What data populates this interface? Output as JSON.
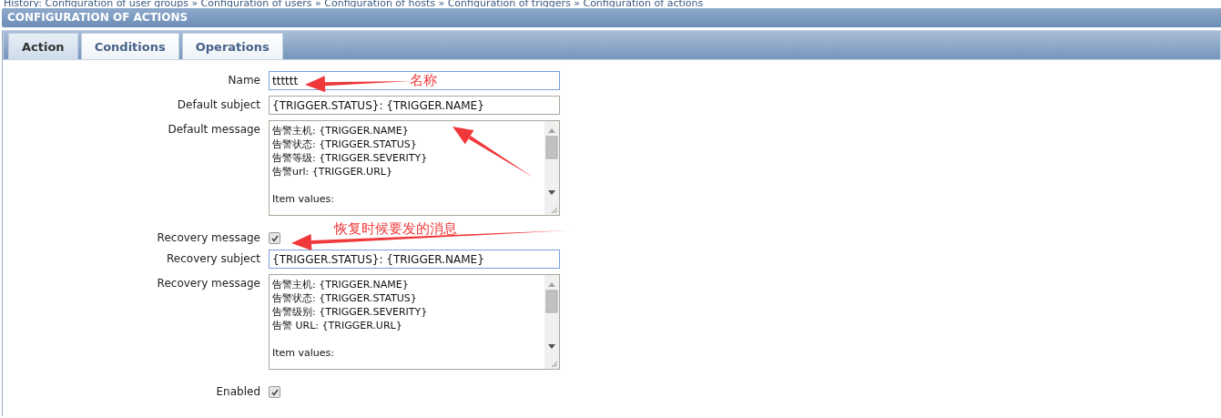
{
  "breadcrumb": "History: Configuration of user groups » Configuration of users » Configuration of hosts » Configuration of triggers » Configuration of actions",
  "header": {
    "title": "CONFIGURATION OF ACTIONS"
  },
  "tabs": [
    {
      "label": "Action",
      "selected": true
    },
    {
      "label": "Conditions",
      "selected": false
    },
    {
      "label": "Operations",
      "selected": false
    }
  ],
  "form": [
    {
      "kind": "input",
      "label": "Name",
      "value": "tttttt",
      "focused": true
    },
    {
      "kind": "input",
      "label": "Default subject",
      "value": "{TRIGGER.STATUS}: {TRIGGER.NAME}",
      "focused": false
    },
    {
      "kind": "textarea",
      "label": "Default message",
      "value": "告警主机: {TRIGGER.NAME}\n告警状态: {TRIGGER.STATUS}\n告警等级: {TRIGGER.SEVERITY}\n告警url: {TRIGGER.URL}\n\nItem values:"
    },
    {
      "kind": "checkbox",
      "label": "Recovery message",
      "checked": true
    },
    {
      "kind": "input",
      "label": "Recovery subject",
      "value": "{TRIGGER.STATUS}: {TRIGGER.NAME}",
      "focused": true
    },
    {
      "kind": "textarea",
      "label": "Recovery message",
      "value": "告警主机: {TRIGGER.NAME}\n告警状态: {TRIGGER.STATUS}\n告警级别: {TRIGGER.SEVERITY}\n告警 URL: {TRIGGER.URL}\n\nItem values:"
    },
    {
      "kind": "checkbox",
      "label": "Enabled",
      "checked": true
    }
  ],
  "annotations": [
    {
      "text": "名称"
    },
    {
      "text": "恢复时候要发的消息"
    }
  ]
}
